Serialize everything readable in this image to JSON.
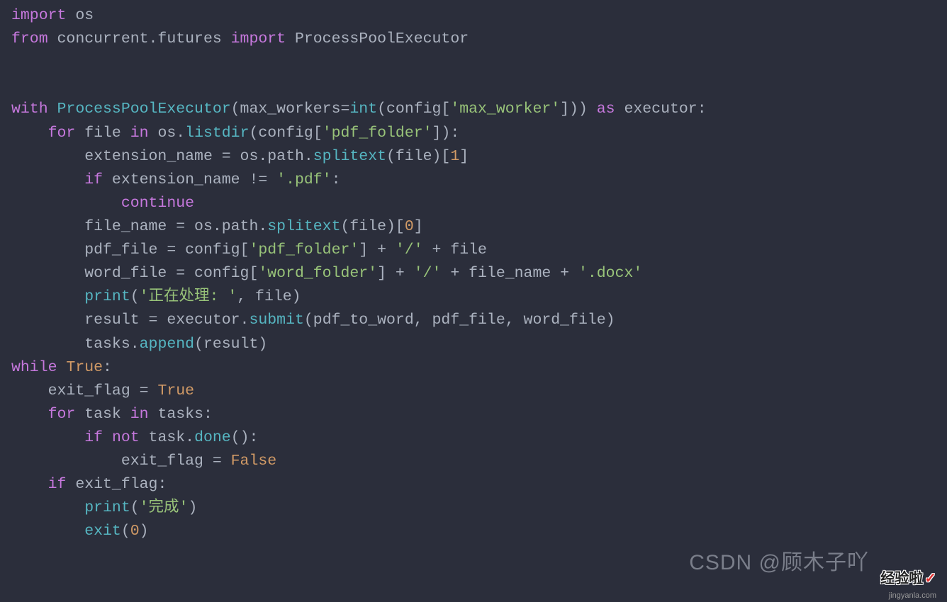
{
  "code": {
    "l1": {
      "t1": "import",
      "t2": " os"
    },
    "l2": {
      "t1": "from",
      "t2": " concurrent.futures ",
      "t3": "import",
      "t4": " ProcessPoolExecutor"
    },
    "l3": "",
    "l4": "",
    "l5": {
      "t1": "with",
      "t2": " ",
      "t3": "ProcessPoolExecutor",
      "t4": "(max_workers=",
      "t5": "int",
      "t6": "(config[",
      "t7": "'max_worker'",
      "t8": "])) ",
      "t9": "as",
      "t10": " executor:"
    },
    "l6": {
      "t1": "    ",
      "t2": "for",
      "t3": " file ",
      "t4": "in",
      "t5": " os.",
      "t6": "listdir",
      "t7": "(config[",
      "t8": "'pdf_folder'",
      "t9": "]):"
    },
    "l7": {
      "t1": "        extension_name = os.path.",
      "t2": "splitext",
      "t3": "(file)[",
      "t4": "1",
      "t5": "]"
    },
    "l8": {
      "t1": "        ",
      "t2": "if",
      "t3": " extension_name != ",
      "t4": "'.pdf'",
      "t5": ":"
    },
    "l9": {
      "t1": "            ",
      "t2": "continue"
    },
    "l10": {
      "t1": "        file_name = os.path.",
      "t2": "splitext",
      "t3": "(file)[",
      "t4": "0",
      "t5": "]"
    },
    "l11": {
      "t1": "        pdf_file = config[",
      "t2": "'pdf_folder'",
      "t3": "] + ",
      "t4": "'/'",
      "t5": " + file"
    },
    "l12": {
      "t1": "        word_file = config[",
      "t2": "'word_folder'",
      "t3": "] + ",
      "t4": "'/'",
      "t5": " + file_name + ",
      "t6": "'.docx'"
    },
    "l13": {
      "t1": "        ",
      "t2": "print",
      "t3": "(",
      "t4": "'正在处理: '",
      "t5": ", file)"
    },
    "l14": {
      "t1": "        result = executor.",
      "t2": "submit",
      "t3": "(pdf_to_word, pdf_file, word_file)"
    },
    "l15": {
      "t1": "        tasks.",
      "t2": "append",
      "t3": "(result)"
    },
    "l16": {
      "t1": "while",
      "t2": " ",
      "t3": "True",
      "t4": ":"
    },
    "l17": {
      "t1": "    exit_flag = ",
      "t2": "True"
    },
    "l18": {
      "t1": "    ",
      "t2": "for",
      "t3": " task ",
      "t4": "in",
      "t5": " tasks:"
    },
    "l19": {
      "t1": "        ",
      "t2": "if",
      "t3": " ",
      "t4": "not",
      "t5": " task.",
      "t6": "done",
      "t7": "():"
    },
    "l20": {
      "t1": "            exit_flag = ",
      "t2": "False"
    },
    "l21": {
      "t1": "    ",
      "t2": "if",
      "t3": " exit_flag:"
    },
    "l22": {
      "t1": "        ",
      "t2": "print",
      "t3": "(",
      "t4": "'完成'",
      "t5": ")"
    },
    "l23": {
      "t1": "        ",
      "t2": "exit",
      "t3": "(",
      "t4": "0",
      "t5": ")"
    }
  },
  "watermark": {
    "csdn": "CSDN @顾木子吖",
    "brand": "经验啦",
    "check": "✓",
    "url": "jingyanla.com"
  }
}
